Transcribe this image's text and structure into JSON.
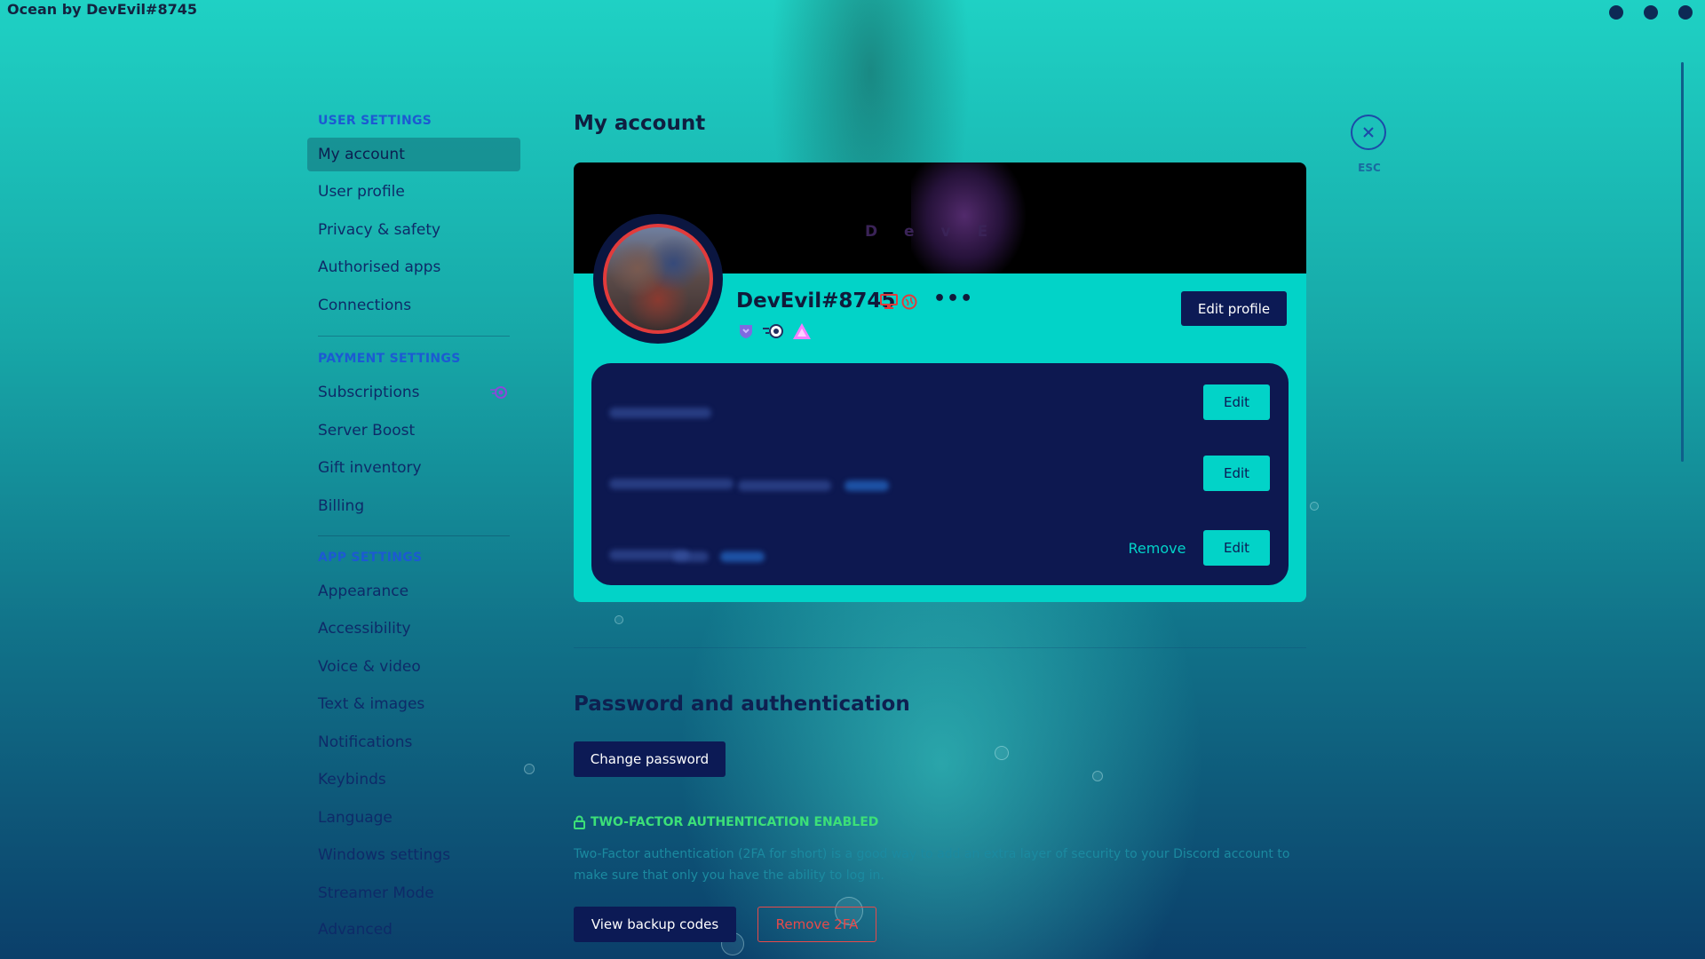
{
  "window": {
    "title": "Ocean by DevEvil#8745"
  },
  "sidebar": {
    "user_settings": {
      "header": "USER SETTINGS",
      "items": [
        "My account",
        "User profile",
        "Privacy & safety",
        "Authorised apps",
        "Connections"
      ]
    },
    "payment_settings": {
      "header": "PAYMENT SETTINGS",
      "items": [
        "Subscriptions",
        "Server Boost",
        "Gift inventory",
        "Billing"
      ]
    },
    "app_settings": {
      "header": "APP SETTINGS",
      "items": [
        "Appearance",
        "Accessibility",
        "Voice & video",
        "Text & images",
        "Notifications",
        "Keybinds",
        "Language",
        "Windows settings",
        "Streamer Mode",
        "Advanced"
      ]
    },
    "active_item": "My account"
  },
  "main": {
    "title": "My account",
    "close": {
      "icon": "close-icon",
      "label": "ESC"
    },
    "profile": {
      "banner_text": "D e v E",
      "username": "DevEvil#8745",
      "edit_profile_label": "Edit profile",
      "status_icons": [
        "desktop-icon",
        "globe-icon"
      ],
      "badges": [
        "hypesquad-badge-icon",
        "nitro-badge-icon",
        "boost-badge-icon"
      ]
    },
    "account_fields": {
      "edit_label_1": "Edit",
      "edit_label_2": "Edit",
      "edit_label_3": "Edit",
      "remove_label": "Remove"
    },
    "password_auth": {
      "title": "Password and authentication",
      "change_password_label": "Change password",
      "tfa_status": "TWO-FACTOR AUTHENTICATION ENABLED",
      "tfa_description": "Two-Factor authentication (2FA for short) is a good way to add an extra layer of security to your Discord account to make sure that only you have the ability to log in.",
      "view_backup_label": "View backup codes",
      "remove_2fa_label": "Remove 2FA"
    }
  },
  "colors": {
    "accent": "#02d3c8",
    "dark": "#0c1a55",
    "danger": "#e84a4a",
    "success": "#3ce078",
    "sidebar_header": "#1c5ad2"
  }
}
